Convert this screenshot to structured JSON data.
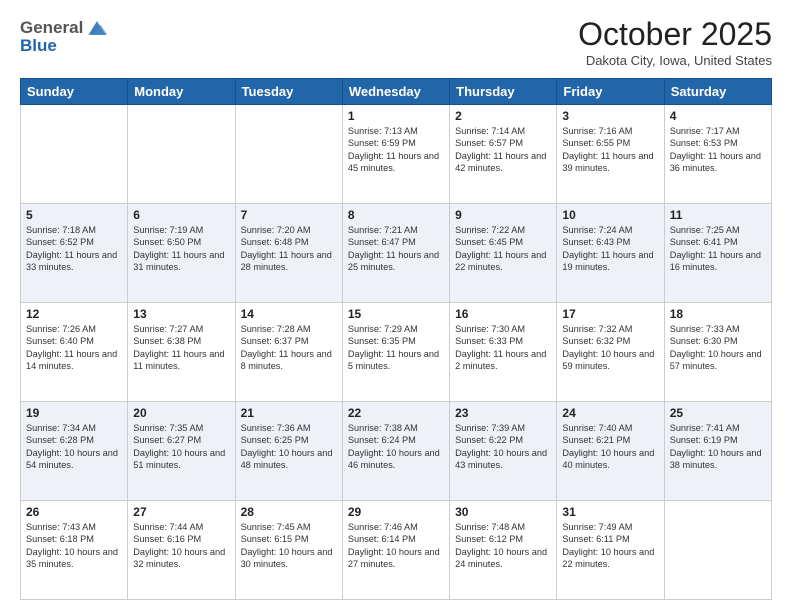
{
  "header": {
    "logo_line1": "General",
    "logo_line2": "Blue",
    "month": "October 2025",
    "location": "Dakota City, Iowa, United States"
  },
  "days_of_week": [
    "Sunday",
    "Monday",
    "Tuesday",
    "Wednesday",
    "Thursday",
    "Friday",
    "Saturday"
  ],
  "weeks": [
    [
      {
        "day": "",
        "info": ""
      },
      {
        "day": "",
        "info": ""
      },
      {
        "day": "",
        "info": ""
      },
      {
        "day": "1",
        "info": "Sunrise: 7:13 AM\nSunset: 6:59 PM\nDaylight: 11 hours and 45 minutes."
      },
      {
        "day": "2",
        "info": "Sunrise: 7:14 AM\nSunset: 6:57 PM\nDaylight: 11 hours and 42 minutes."
      },
      {
        "day": "3",
        "info": "Sunrise: 7:16 AM\nSunset: 6:55 PM\nDaylight: 11 hours and 39 minutes."
      },
      {
        "day": "4",
        "info": "Sunrise: 7:17 AM\nSunset: 6:53 PM\nDaylight: 11 hours and 36 minutes."
      }
    ],
    [
      {
        "day": "5",
        "info": "Sunrise: 7:18 AM\nSunset: 6:52 PM\nDaylight: 11 hours and 33 minutes."
      },
      {
        "day": "6",
        "info": "Sunrise: 7:19 AM\nSunset: 6:50 PM\nDaylight: 11 hours and 31 minutes."
      },
      {
        "day": "7",
        "info": "Sunrise: 7:20 AM\nSunset: 6:48 PM\nDaylight: 11 hours and 28 minutes."
      },
      {
        "day": "8",
        "info": "Sunrise: 7:21 AM\nSunset: 6:47 PM\nDaylight: 11 hours and 25 minutes."
      },
      {
        "day": "9",
        "info": "Sunrise: 7:22 AM\nSunset: 6:45 PM\nDaylight: 11 hours and 22 minutes."
      },
      {
        "day": "10",
        "info": "Sunrise: 7:24 AM\nSunset: 6:43 PM\nDaylight: 11 hours and 19 minutes."
      },
      {
        "day": "11",
        "info": "Sunrise: 7:25 AM\nSunset: 6:41 PM\nDaylight: 11 hours and 16 minutes."
      }
    ],
    [
      {
        "day": "12",
        "info": "Sunrise: 7:26 AM\nSunset: 6:40 PM\nDaylight: 11 hours and 14 minutes."
      },
      {
        "day": "13",
        "info": "Sunrise: 7:27 AM\nSunset: 6:38 PM\nDaylight: 11 hours and 11 minutes."
      },
      {
        "day": "14",
        "info": "Sunrise: 7:28 AM\nSunset: 6:37 PM\nDaylight: 11 hours and 8 minutes."
      },
      {
        "day": "15",
        "info": "Sunrise: 7:29 AM\nSunset: 6:35 PM\nDaylight: 11 hours and 5 minutes."
      },
      {
        "day": "16",
        "info": "Sunrise: 7:30 AM\nSunset: 6:33 PM\nDaylight: 11 hours and 2 minutes."
      },
      {
        "day": "17",
        "info": "Sunrise: 7:32 AM\nSunset: 6:32 PM\nDaylight: 10 hours and 59 minutes."
      },
      {
        "day": "18",
        "info": "Sunrise: 7:33 AM\nSunset: 6:30 PM\nDaylight: 10 hours and 57 minutes."
      }
    ],
    [
      {
        "day": "19",
        "info": "Sunrise: 7:34 AM\nSunset: 6:28 PM\nDaylight: 10 hours and 54 minutes."
      },
      {
        "day": "20",
        "info": "Sunrise: 7:35 AM\nSunset: 6:27 PM\nDaylight: 10 hours and 51 minutes."
      },
      {
        "day": "21",
        "info": "Sunrise: 7:36 AM\nSunset: 6:25 PM\nDaylight: 10 hours and 48 minutes."
      },
      {
        "day": "22",
        "info": "Sunrise: 7:38 AM\nSunset: 6:24 PM\nDaylight: 10 hours and 46 minutes."
      },
      {
        "day": "23",
        "info": "Sunrise: 7:39 AM\nSunset: 6:22 PM\nDaylight: 10 hours and 43 minutes."
      },
      {
        "day": "24",
        "info": "Sunrise: 7:40 AM\nSunset: 6:21 PM\nDaylight: 10 hours and 40 minutes."
      },
      {
        "day": "25",
        "info": "Sunrise: 7:41 AM\nSunset: 6:19 PM\nDaylight: 10 hours and 38 minutes."
      }
    ],
    [
      {
        "day": "26",
        "info": "Sunrise: 7:43 AM\nSunset: 6:18 PM\nDaylight: 10 hours and 35 minutes."
      },
      {
        "day": "27",
        "info": "Sunrise: 7:44 AM\nSunset: 6:16 PM\nDaylight: 10 hours and 32 minutes."
      },
      {
        "day": "28",
        "info": "Sunrise: 7:45 AM\nSunset: 6:15 PM\nDaylight: 10 hours and 30 minutes."
      },
      {
        "day": "29",
        "info": "Sunrise: 7:46 AM\nSunset: 6:14 PM\nDaylight: 10 hours and 27 minutes."
      },
      {
        "day": "30",
        "info": "Sunrise: 7:48 AM\nSunset: 6:12 PM\nDaylight: 10 hours and 24 minutes."
      },
      {
        "day": "31",
        "info": "Sunrise: 7:49 AM\nSunset: 6:11 PM\nDaylight: 10 hours and 22 minutes."
      },
      {
        "day": "",
        "info": ""
      }
    ]
  ]
}
